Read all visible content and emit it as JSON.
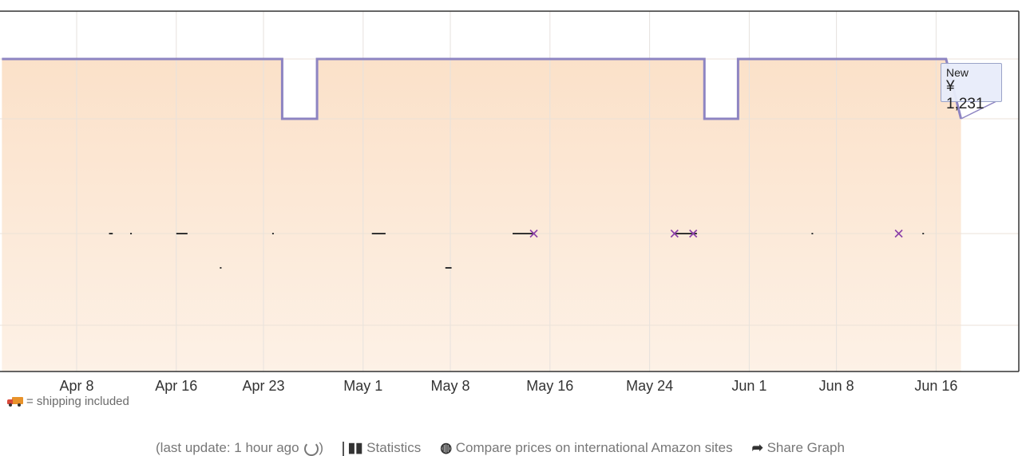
{
  "chart_data": {
    "type": "line",
    "x_axis": {
      "ticks": [
        "Apr 8",
        "Apr 16",
        "Apr 23",
        "May 1",
        "May 8",
        "May 16",
        "May 24",
        "Jun 1",
        "Jun 8",
        "Jun 16"
      ]
    },
    "series": [
      {
        "name": "New",
        "color": "#8d84c2",
        "points": [
          {
            "x": "Apr 2",
            "y": "high"
          },
          {
            "x": "Apr 24.5",
            "y": "high"
          },
          {
            "x": "Apr 24.5",
            "y": "low"
          },
          {
            "x": "Apr 27.3",
            "y": "low"
          },
          {
            "x": "Apr 27.3",
            "y": "high"
          },
          {
            "x": "May 28.4",
            "y": "high"
          },
          {
            "x": "May 28.4",
            "y": "low"
          },
          {
            "x": "May 31.1",
            "y": "low"
          },
          {
            "x": "May 31.1",
            "y": "high"
          },
          {
            "x": "Jun 16.8",
            "y": "high"
          },
          {
            "x": "Jun 18",
            "y": "low"
          }
        ]
      }
    ],
    "current_point_label": {
      "series": "New",
      "value": "¥ 1,231"
    },
    "markers": {
      "dashes": [
        {
          "row": 1,
          "x_from": "Apr 10.6",
          "x_to": "Apr 10.9"
        },
        {
          "row": 1,
          "x_from": "Apr 12.3",
          "x_to": "Apr 12.4"
        },
        {
          "row": 1,
          "x_from": "Apr 16",
          "x_to": "Apr 16.9"
        },
        {
          "row": 1,
          "x_from": "Apr 23.7",
          "x_to": "Apr 23.8"
        },
        {
          "row": 2,
          "x_from": "Apr 19.5",
          "x_to": "Apr 19.6"
        },
        {
          "row": 1,
          "x_from": "May 1.7",
          "x_to": "May 2.8"
        },
        {
          "row": 2,
          "x_from": "May 7.6",
          "x_to": "May 8.1"
        },
        {
          "row": 1,
          "x_from": "May 13",
          "x_to": "May 14.7"
        },
        {
          "row": 1,
          "x_from": "May 26",
          "x_to": "May 27.8"
        },
        {
          "row": 1,
          "x_from": "Jun 6",
          "x_to": "Jun 6.1"
        },
        {
          "row": 1,
          "x_from": "Jun 14.9",
          "x_to": "Jun 15"
        }
      ],
      "crosses": [
        "May 14.7",
        "May 26",
        "May 27.5",
        "Jun 13"
      ],
      "cross_color": "#8a3fa8",
      "dash_color": "#333333"
    },
    "grid": true,
    "background": "#fce8d6"
  },
  "tooltip": {
    "line1": "New",
    "line2": "¥ 1,231"
  },
  "legend_note": {
    "text": "= shipping included",
    "icon": "truck-icon"
  },
  "footer": {
    "last_update": "(last update: 1 hour ago",
    "statistics": "Statistics",
    "compare": "Compare prices on international Amazon sites",
    "share": "Share Graph"
  }
}
